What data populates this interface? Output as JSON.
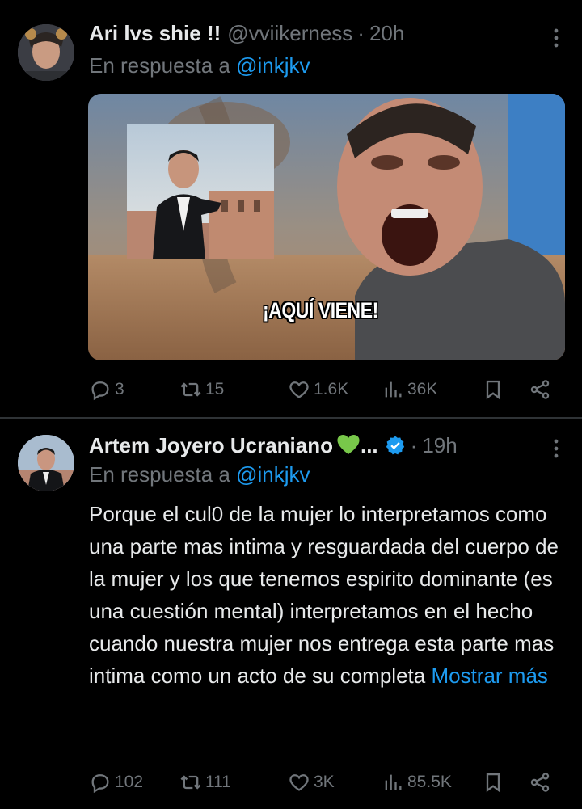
{
  "tweet1": {
    "display_name": "Ari lvs shie !!",
    "handle": "@vviikerness",
    "separator": "·",
    "time": "20h",
    "reply_prefix": "En respuesta a",
    "reply_mention": "@inkjkv",
    "media_caption": "¡AQUÍ VIENE!",
    "stats": {
      "replies": "3",
      "retweets": "15",
      "likes": "1.6K",
      "views": "36K"
    }
  },
  "tweet2": {
    "display_name": "Artem Joyero Ucraniano",
    "name_suffix": "...",
    "separator": "·",
    "time": "19h",
    "reply_prefix": "En respuesta a",
    "reply_mention": "@inkjkv",
    "text": "Porque el cul0 de la mujer lo interpretamos como una parte mas intima y resguardada del cuerpo de la mujer y los que tenemos espirito dominante (es una cuestión mental) interpretamos en el hecho cuando nuestra mujer nos entrega esta parte mas intima como un acto de su completa",
    "show_more": "Mostrar más",
    "stats": {
      "replies": "102",
      "retweets": "111",
      "likes": "3K",
      "views": "85.5K"
    }
  },
  "colors": {
    "background": "#000000",
    "text": "#e7e9ea",
    "muted": "#71767b",
    "accent": "#1d9bf0",
    "divider": "#2f3336"
  },
  "icons": [
    "more-icon",
    "reply-icon",
    "retweet-icon",
    "like-icon",
    "views-icon",
    "bookmark-icon",
    "share-icon",
    "verified-icon",
    "green-heart-emoji"
  ]
}
